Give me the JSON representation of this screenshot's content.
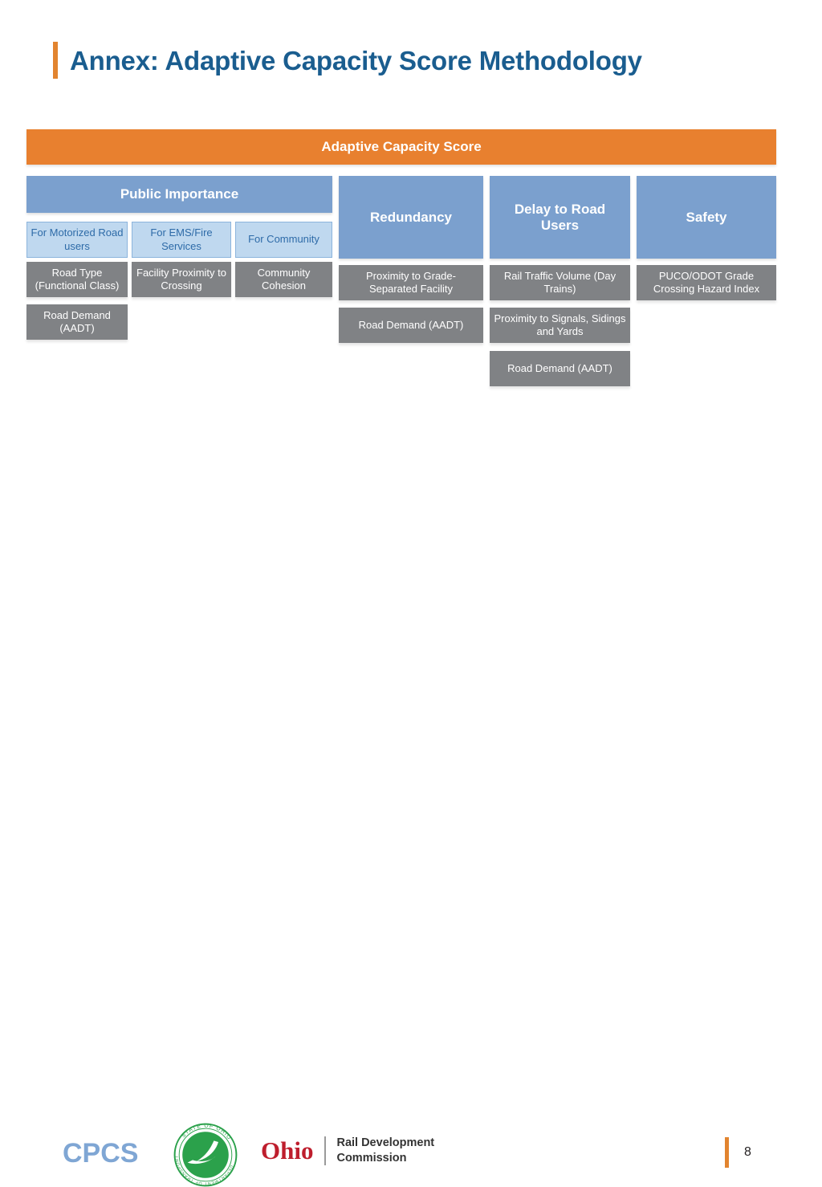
{
  "slide": {
    "title": "Annex: Adaptive Capacity Score Methodology",
    "page_number": "8",
    "accent_color": "#E2842F",
    "title_color": "#1A5D8F"
  },
  "diagram": {
    "score_bar": {
      "label": "Adaptive Capacity Score",
      "color": "#E8802F"
    },
    "category_color": "#7BA0CE",
    "subheader_color": "#BFD8EF",
    "metric_color": "#808285",
    "columns": [
      {
        "name": "public-importance",
        "label": "Public Importance",
        "subcolumns": [
          {
            "name": "for-motorized-road-users",
            "label": "For Motorized Road users",
            "metrics": [
              "Road Type (Functional Class)",
              "Road Demand (AADT)"
            ]
          },
          {
            "name": "for-ems-fire-services",
            "label": "For EMS/Fire Services",
            "metrics": [
              "Facility Proximity to Crossing"
            ]
          },
          {
            "name": "for-community",
            "label": "For Community",
            "metrics": [
              "Community Cohesion"
            ]
          }
        ]
      },
      {
        "name": "redundancy",
        "label": "Redundancy",
        "subcolumns": [],
        "metrics": [
          "Proximity to Grade-Separated Facility",
          "Road Demand (AADT)"
        ]
      },
      {
        "name": "delay-to-road-users",
        "label": "Delay to Road Users",
        "subcolumns": [],
        "metrics": [
          "Rail Traffic Volume (Day Trains)",
          "Proximity to Signals, Sidings and Yards",
          "Road Demand (AADT)"
        ]
      },
      {
        "name": "safety",
        "label": "Safety",
        "subcolumns": [],
        "metrics": [
          "PUCO/ODOT Grade Crossing Hazard Index"
        ]
      }
    ]
  },
  "footer": {
    "cpcs_logo_text": "CPCS",
    "odot_seal": {
      "outer_text_top": "STATE OF OHIO",
      "outer_text_bottom": "DEPARTMENT OF TRANSPORTATION",
      "color": "#2BA14B"
    },
    "orc_logo": {
      "ohio": "Ohio",
      "line1": "Rail Development",
      "line2": "Commission",
      "ohio_color": "#BE1E2D"
    }
  }
}
